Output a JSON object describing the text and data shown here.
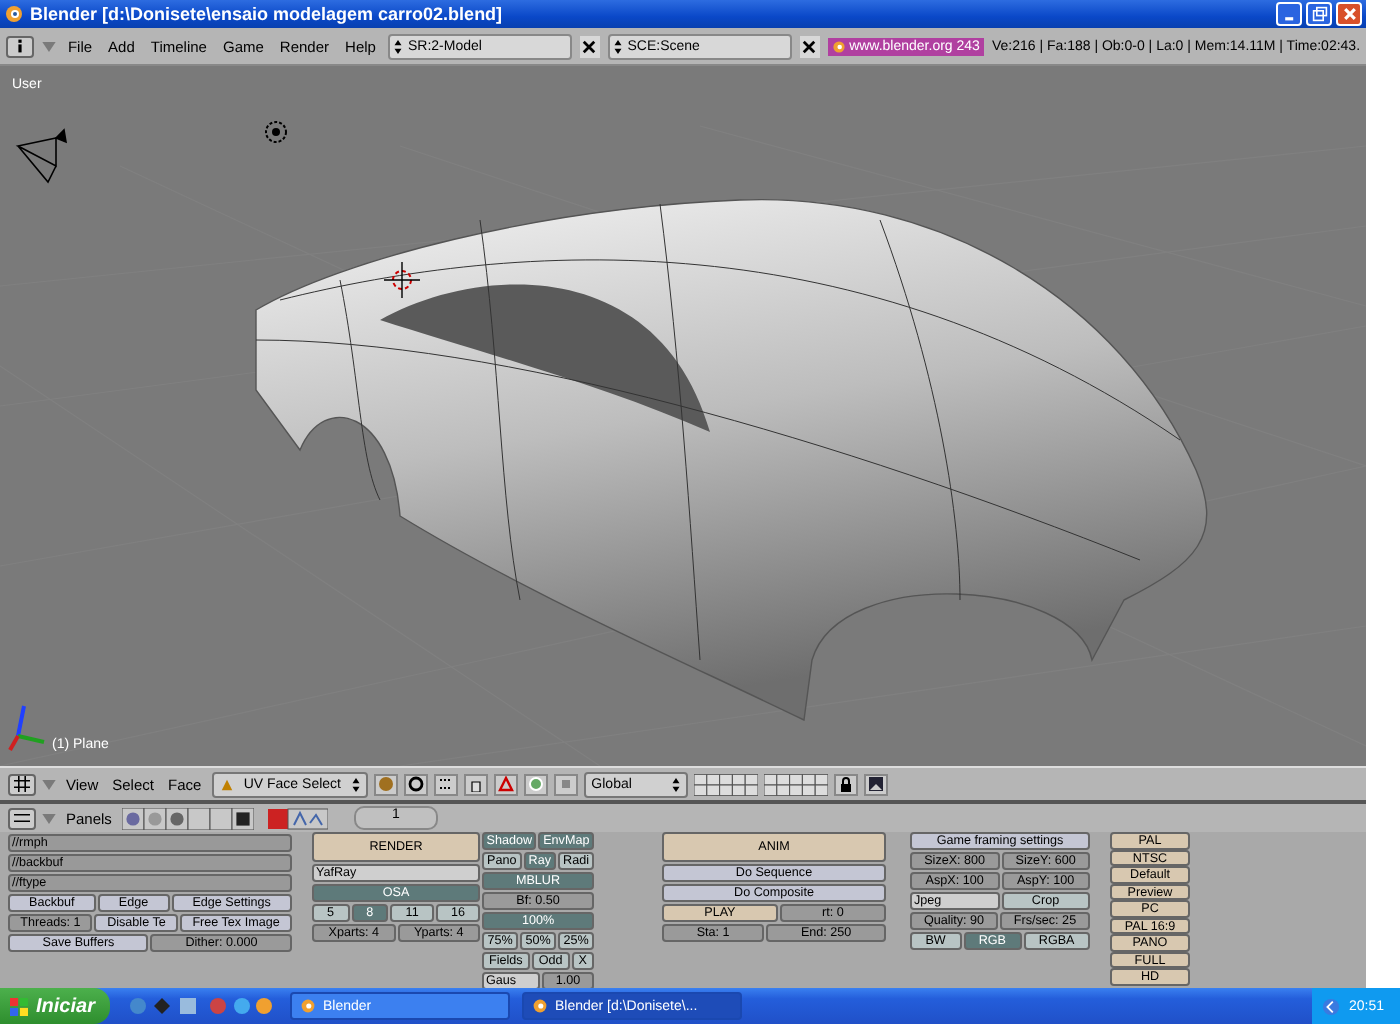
{
  "window": {
    "title": "Blender [d:\\Donisete\\ensaio modelagem carro02.blend]"
  },
  "menu_bar": {
    "menus": [
      "File",
      "Add",
      "Timeline",
      "Game",
      "Render",
      "Help"
    ],
    "screen": "SR:2-Model",
    "scene": "SCE:Scene",
    "link": "www.blender.org 243",
    "stats": "Ve:216 | Fa:188 | Ob:0-0 | La:0 | Mem:14.11M | Time:02:43."
  },
  "viewport": {
    "view_label": "User",
    "object_label": "(1) Plane"
  },
  "view_header": {
    "menus": [
      "View",
      "Select",
      "Face"
    ],
    "mode": "UV Face Select",
    "orientation": "Global"
  },
  "buttons_header": {
    "label": "Panels",
    "frame": "1"
  },
  "properties": {
    "columns": [
      {
        "rows": [
          {
            "buttons": [
              {
                "label": "//rmph",
                "kind": "text"
              }
            ]
          },
          {
            "buttons": [
              {
                "label": "//backbuf",
                "kind": "text"
              }
            ]
          },
          {
            "buttons": [
              {
                "label": "//ftype",
                "kind": "text"
              }
            ]
          },
          {
            "buttons": [
              {
                "label": "Backbuf",
                "kind": "push"
              },
              {
                "label": "Edge",
                "kind": "push"
              },
              {
                "label": "Edge Settings",
                "kind": "push"
              }
            ]
          },
          {
            "buttons": [
              {
                "label": "Threads: 1",
                "kind": "num"
              },
              {
                "label": "Disable Te",
                "kind": "push"
              },
              {
                "label": "Free Tex Image",
                "kind": "push"
              }
            ]
          },
          {
            "buttons": [
              {
                "label": "Save Buffers",
                "kind": "push"
              },
              {
                "label": "Dither: 0.000",
                "kind": "num"
              }
            ]
          }
        ]
      },
      {
        "rows": [
          {
            "buttons": [
              {
                "label": "RENDER",
                "kind": "action"
              }
            ]
          },
          {
            "buttons": [
              {
                "label": "YafRay",
                "kind": "menu"
              }
            ]
          },
          {
            "buttons": [
              {
                "label": "OSA",
                "kind": "toggle",
                "selected": true
              }
            ]
          },
          {
            "buttons": [
              {
                "label": "5",
                "kind": "toggle",
                "selected": false
              },
              {
                "label": "8",
                "kind": "toggle",
                "selected": true
              },
              {
                "label": "11",
                "kind": "toggle",
                "selected": false
              },
              {
                "label": "16",
                "kind": "toggle",
                "selected": false
              }
            ]
          },
          {
            "buttons": [
              {
                "label": "Xparts: 4",
                "kind": "num"
              },
              {
                "label": "Yparts: 4",
                "kind": "num"
              }
            ]
          }
        ]
      },
      {
        "rows": [
          {
            "buttons": [
              {
                "label": "Shadow",
                "kind": "toggle",
                "selected": true
              },
              {
                "label": "EnvMap",
                "kind": "toggle",
                "selected": true
              }
            ]
          },
          {
            "buttons": [
              {
                "label": "Pano",
                "kind": "toggle",
                "selected": false
              },
              {
                "label": "Ray",
                "kind": "toggle",
                "selected": true
              },
              {
                "label": "Radi",
                "kind": "toggle",
                "selected": false
              }
            ]
          },
          {
            "buttons": [
              {
                "label": "MBLUR",
                "kind": "toggle",
                "selected": true
              }
            ]
          },
          {
            "buttons": [
              {
                "label": "Bf: 0.50",
                "kind": "num"
              }
            ]
          },
          {
            "buttons": [
              {
                "label": "100%",
                "kind": "toggle",
                "selected": true
              }
            ]
          },
          {
            "buttons": [
              {
                "label": "75%",
                "kind": "toggle",
                "selected": false
              },
              {
                "label": "50%",
                "kind": "toggle",
                "selected": false
              },
              {
                "label": "25%",
                "kind": "toggle",
                "selected": false
              }
            ]
          },
          {
            "buttons": [
              {
                "label": "Fields",
                "kind": "toggle",
                "selected": false
              },
              {
                "label": "Odd",
                "kind": "toggle",
                "selected": false
              },
              {
                "label": "X",
                "kind": "toggle",
                "selected": false
              }
            ]
          },
          {
            "buttons": [
              {
                "label": "Gaus",
                "kind": "menu"
              },
              {
                "label": "1.00",
                "kind": "num"
              }
            ]
          }
        ]
      },
      {
        "rows": [
          {
            "buttons": [
              {
                "label": "ANIM",
                "kind": "action"
              }
            ]
          },
          {
            "buttons": [
              {
                "label": "Do Sequence",
                "kind": "push"
              }
            ]
          },
          {
            "buttons": [
              {
                "label": "Do Composite",
                "kind": "push"
              }
            ]
          },
          {
            "buttons": [
              {
                "label": "PLAY",
                "kind": "action"
              },
              {
                "label": "rt: 0",
                "kind": "num"
              }
            ]
          },
          {
            "buttons": [
              {
                "label": "Sta: 1",
                "kind": "num"
              },
              {
                "label": "End: 250",
                "kind": "num"
              }
            ]
          }
        ]
      },
      {
        "rows": [
          {
            "buttons": [
              {
                "label": "Game framing settings",
                "kind": "push"
              }
            ]
          },
          {
            "buttons": [
              {
                "label": "SizeX: 800",
                "kind": "num"
              },
              {
                "label": "SizeY: 600",
                "kind": "num"
              }
            ]
          },
          {
            "buttons": [
              {
                "label": "AspX: 100",
                "kind": "num"
              },
              {
                "label": "AspY: 100",
                "kind": "num"
              }
            ]
          },
          {
            "buttons": [
              {
                "label": "Jpeg",
                "kind": "menu"
              },
              {
                "label": "Crop",
                "kind": "toggle",
                "selected": false
              }
            ]
          },
          {
            "buttons": [
              {
                "label": "Quality: 90",
                "kind": "num"
              },
              {
                "label": "Frs/sec: 25",
                "kind": "num"
              }
            ]
          },
          {
            "buttons": [
              {
                "label": "BW",
                "kind": "toggle",
                "selected": false
              },
              {
                "label": "RGB",
                "kind": "toggle",
                "selected": true
              },
              {
                "label": "RGBA",
                "kind": "toggle",
                "selected": false
              }
            ]
          }
        ]
      },
      {
        "rows": [
          {
            "buttons": [
              {
                "label": "PAL",
                "kind": "action"
              }
            ]
          },
          {
            "buttons": [
              {
                "label": "NTSC",
                "kind": "action"
              }
            ]
          },
          {
            "buttons": [
              {
                "label": "Default",
                "kind": "action"
              }
            ]
          },
          {
            "buttons": [
              {
                "label": "Preview",
                "kind": "action"
              }
            ]
          },
          {
            "buttons": [
              {
                "label": "PC",
                "kind": "action"
              }
            ]
          },
          {
            "buttons": [
              {
                "label": "PAL 16:9",
                "kind": "action"
              }
            ]
          },
          {
            "buttons": [
              {
                "label": "PANO",
                "kind": "action"
              }
            ]
          },
          {
            "buttons": [
              {
                "label": "FULL",
                "kind": "action"
              }
            ]
          },
          {
            "buttons": [
              {
                "label": "HD",
                "kind": "action"
              }
            ]
          }
        ]
      }
    ]
  },
  "taskbar": {
    "start": "Iniciar",
    "tasks": [
      {
        "label": "Blender",
        "selected": false
      },
      {
        "label": "Blender [d:\\Donisete\\...",
        "selected": true
      }
    ],
    "clock": "20:51"
  }
}
